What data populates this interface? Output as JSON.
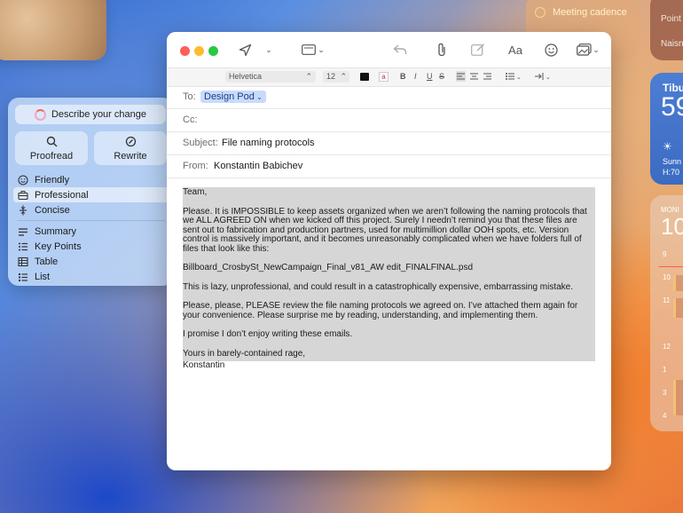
{
  "widgets": {
    "meeting": {
      "label": "Meeting cadence"
    },
    "right_top": {
      "line1": "Point",
      "line2": "Naisn"
    },
    "weather": {
      "city": "Tibu",
      "temp": "59",
      "condition": "Sunn",
      "hilo": "H:70"
    },
    "calendar": {
      "day": "MONI",
      "date": "10",
      "hours": [
        "9",
        "10",
        "11",
        "12",
        "1",
        "2",
        "3",
        "4"
      ]
    }
  },
  "writing_tools": {
    "describe": "Describe your change",
    "proofread": "Proofread",
    "rewrite": "Rewrite",
    "tones": [
      {
        "label": "Friendly",
        "icon": "smile-icon"
      },
      {
        "label": "Professional",
        "icon": "briefcase-icon",
        "selected": true
      },
      {
        "label": "Concise",
        "icon": "concise-icon"
      }
    ],
    "formats": [
      {
        "label": "Summary",
        "icon": "summary-icon"
      },
      {
        "label": "Key Points",
        "icon": "key-points-icon"
      },
      {
        "label": "Table",
        "icon": "table-icon"
      },
      {
        "label": "List",
        "icon": "list-icon"
      }
    ]
  },
  "mail": {
    "format": {
      "font": "Helvetica",
      "size": "12",
      "bold": "B",
      "italic": "I",
      "underline": "U",
      "strike": "S"
    },
    "to_label": "To:",
    "to_value": "Design Pod",
    "cc_label": "Cc:",
    "subject_label": "Subject:",
    "subject_value": "File naming protocols",
    "from_label": "From:",
    "from_value": "Konstantin Babichev",
    "body": [
      "Team,",
      "Please. It is IMPOSSIBLE to keep assets organized when we aren’t following the naming protocols that we ALL AGREED ON when we kicked off this project. Surely I needn’t remind you that these files are sent out to fabrication and production partners, used for multimillion dollar OOH spots, etc. Version control is massively important, and it becomes unreasonably complicated when we have folders full of files that look like this:",
      "Billboard_CrosbySt_NewCampaign_Final_v81_AW edit_FINALFINAL.psd",
      "This is lazy, unprofessional, and could result in a catastrophically expensive, embarrassing mistake.",
      "Please, please, PLEASE review the file naming protocols we agreed on. I’ve attached them again for your convenience. Please surprise me by reading, understanding, and implementing them.",
      "I promise I don’t enjoy writing these emails.",
      "Yours in barely-contained rage,"
    ],
    "signoff": "Konstantin"
  }
}
